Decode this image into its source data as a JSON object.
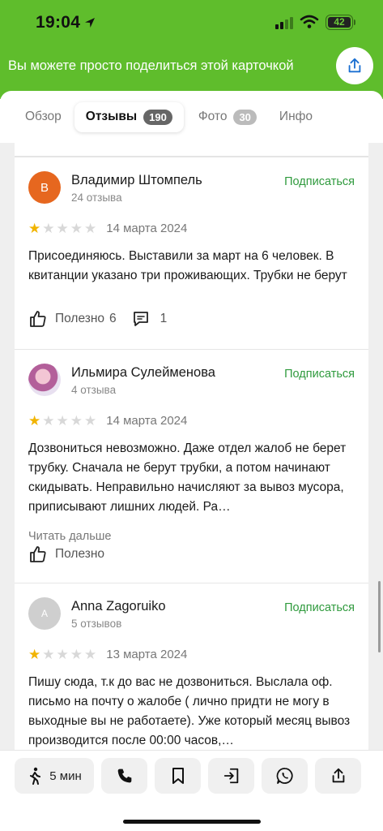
{
  "status_bar": {
    "time": "19:04",
    "battery": "42"
  },
  "banner": {
    "text": "Вы можете просто поделиться этой карточкой"
  },
  "tabs": [
    {
      "label": "Обзор",
      "count": ""
    },
    {
      "label": "Отзывы",
      "count": "190"
    },
    {
      "label": "Фото",
      "count": "30"
    },
    {
      "label": "Инфо",
      "count": ""
    }
  ],
  "reviews": [
    {
      "avatar_letter": "В",
      "name": "Владимир Штомпель",
      "reviews_count": "24 отзыва",
      "follow": "Подписаться",
      "rating": 1,
      "date": "14 марта 2024",
      "text": "Присоединяюсь. Выставили за март на 6 человек. В квитанции указано три проживающих. Трубки не берут",
      "useful_label": "Полезно",
      "useful_count": "6",
      "comments_count": "1"
    },
    {
      "avatar_letter": "",
      "name": "Ильмира Сулейменова",
      "reviews_count": "4 отзыва",
      "follow": "Подписаться",
      "rating": 1,
      "date": "14 марта 2024",
      "text": "Дозвониться невозможно. Даже отдел жалоб не берет трубку. Сначала не берут трубки, а потом начинают скидывать. Неправильно начисляют за вывоз мусора, приписывают лишних людей. Ра…",
      "read_more": "Читать дальше",
      "useful_label": "Полезно"
    },
    {
      "avatar_letter": "A",
      "name": "Anna Zagoruiko",
      "reviews_count": "5 отзывов",
      "follow": "Подписаться",
      "rating": 1,
      "date": "13 марта 2024",
      "text": "Пишу сюда, т.к до вас не дозвониться. Выслала оф. письмо на почту о жалобе ( лично придти не могу в выходные вы не работаете). Уже который месяц вывоз производится после 00:00 часов,…"
    }
  ],
  "bottom_bar": {
    "walk_label": "5 мин"
  },
  "colors": {
    "brand_green": "#5fbd2c",
    "follow_green": "#2f9a3d",
    "star_on": "#f1b400",
    "star_off": "#d8d8d8"
  },
  "icons": [
    "location-arrow-icon",
    "signal-icon",
    "wifi-icon",
    "share-icon",
    "thumbs-up-icon",
    "comment-icon",
    "walk-icon",
    "phone-icon",
    "bookmark-icon",
    "enter-route-icon",
    "whatsapp-icon",
    "share-icon"
  ]
}
